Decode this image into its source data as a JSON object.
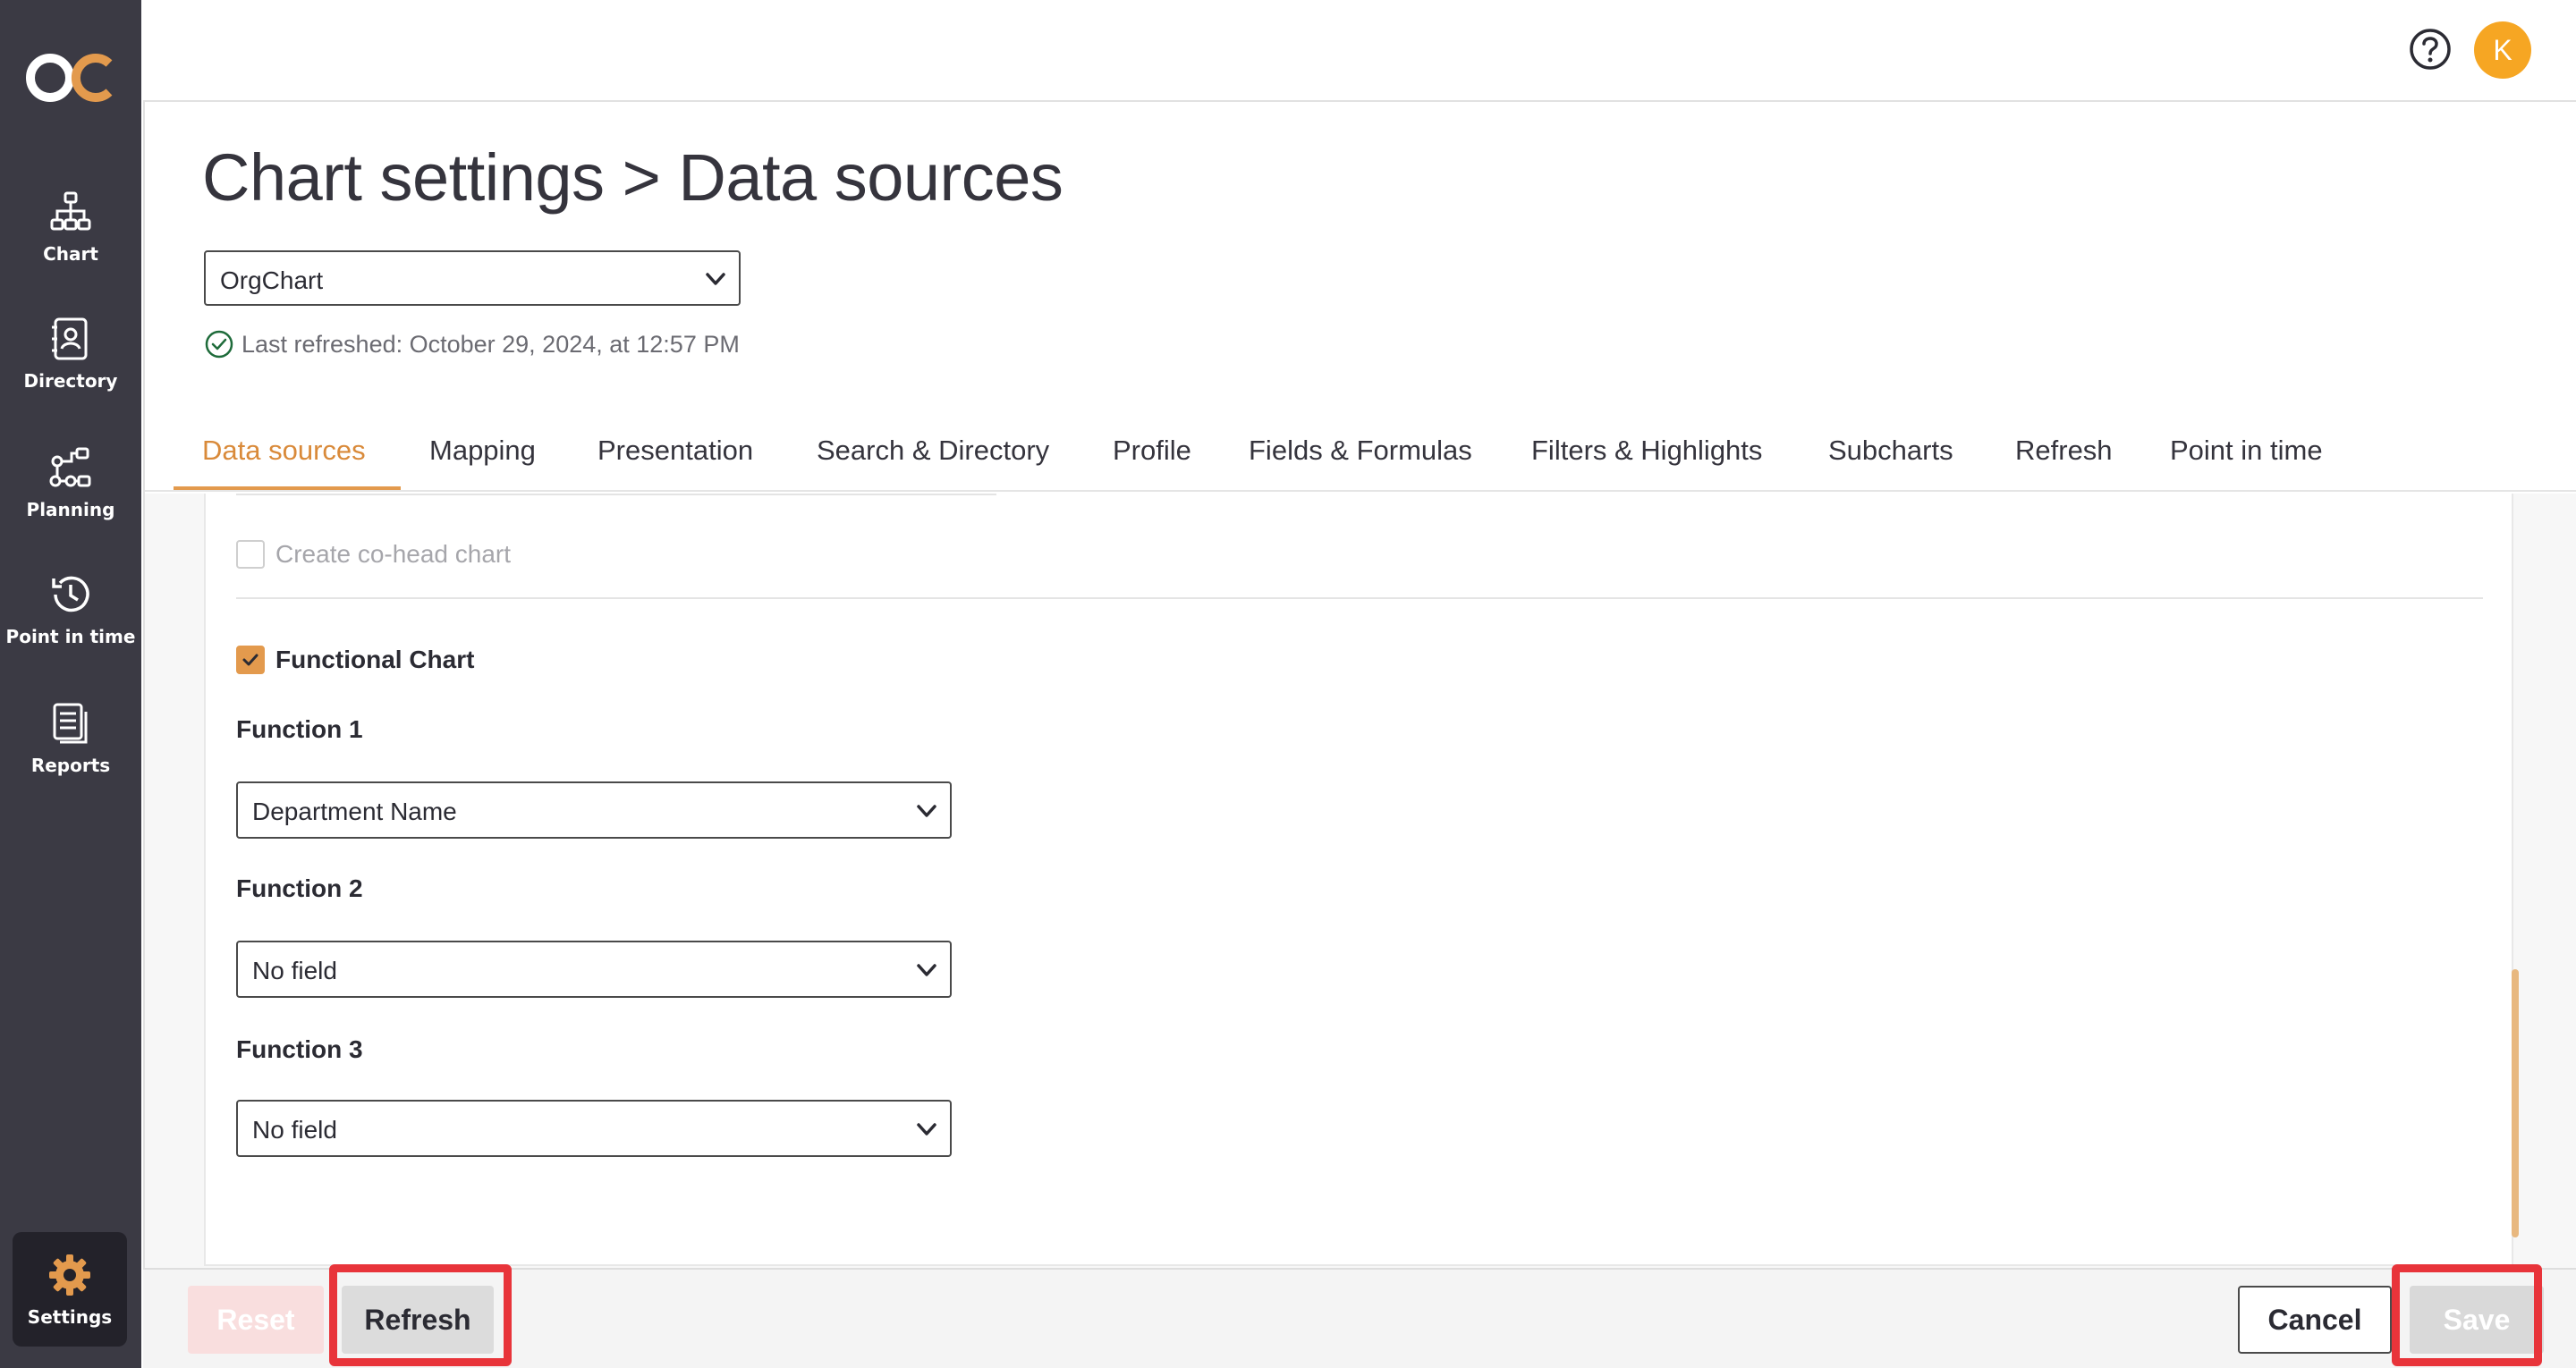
{
  "app": {
    "logo_text": "OC",
    "colors": {
      "accent": "#e39a4d",
      "sidebar": "#3b3a44",
      "avatar": "#f6a623",
      "highlight": "#e8343a"
    }
  },
  "sidebar": {
    "items": [
      {
        "label": "Chart",
        "icon": "org-chart-icon"
      },
      {
        "label": "Directory",
        "icon": "contact-book-icon"
      },
      {
        "label": "Planning",
        "icon": "planning-flow-icon"
      },
      {
        "label": "Point in time",
        "icon": "history-clock-icon"
      },
      {
        "label": "Reports",
        "icon": "report-pages-icon"
      }
    ],
    "settings_label": "Settings"
  },
  "topbar": {
    "avatar_initial": "K",
    "help_icon": "question-circle-icon"
  },
  "page": {
    "title": "Chart settings > Data sources",
    "chart_select_value": "OrgChart",
    "last_refreshed": "Last refreshed: October 29, 2024, at 12:57 PM"
  },
  "tabs": [
    {
      "label": "Data sources",
      "active": true
    },
    {
      "label": "Mapping"
    },
    {
      "label": "Presentation"
    },
    {
      "label": "Search & Directory"
    },
    {
      "label": "Profile"
    },
    {
      "label": "Fields & Formulas"
    },
    {
      "label": "Filters & Highlights"
    },
    {
      "label": "Subcharts"
    },
    {
      "label": "Refresh"
    },
    {
      "label": "Point in time"
    }
  ],
  "content": {
    "co_head_label": "Create co-head chart",
    "co_head_checked": false,
    "functional_label": "Functional Chart",
    "functional_checked": true,
    "functions": [
      {
        "label": "Function 1",
        "value": "Department Name"
      },
      {
        "label": "Function 2",
        "value": "No field"
      },
      {
        "label": "Function 3",
        "value": "No field"
      }
    ]
  },
  "footer": {
    "reset_label": "Reset",
    "refresh_label": "Refresh",
    "cancel_label": "Cancel",
    "save_label": "Save"
  }
}
